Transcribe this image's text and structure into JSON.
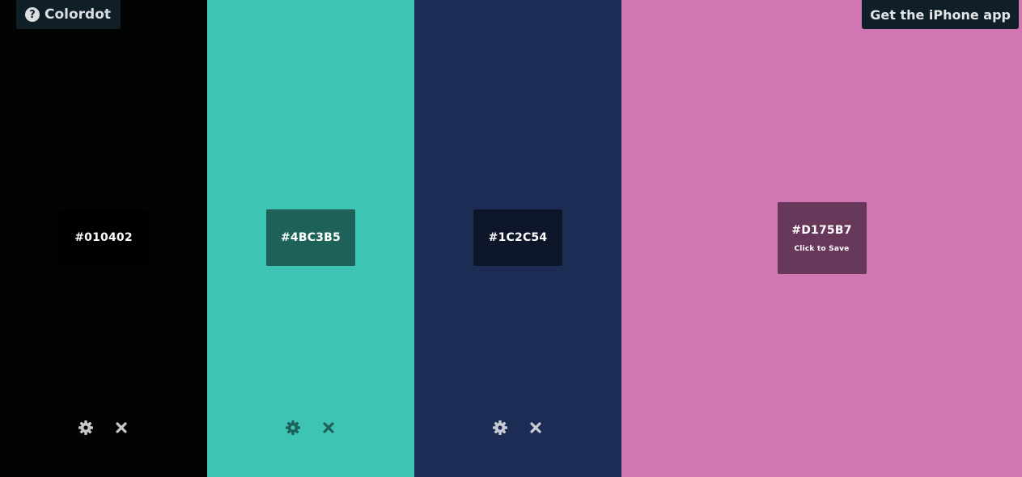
{
  "header": {
    "logo_text": "Colordot",
    "help_icon": "?",
    "app_link": "Get the iPhone app"
  },
  "palette": [
    {
      "hex": "#010402",
      "bg": "#010402",
      "box": "#000000",
      "icon_color": "#c8c8c8"
    },
    {
      "hex": "#4BC3B5",
      "bg": "#3DC4B5",
      "box": "#1E6159",
      "icon_color": "#1e6159"
    },
    {
      "hex": "#1C2C54",
      "bg": "#1C2C54",
      "box": "#0E162A",
      "icon_color": "#c8cbd3"
    }
  ],
  "active": {
    "hex": "#D175B7",
    "bg": "#D175B3",
    "box": "#68385B",
    "hint": "Click to Save"
  },
  "icons": {
    "settings": "gear-icon",
    "remove": "close-icon",
    "help": "question-circle-icon"
  }
}
